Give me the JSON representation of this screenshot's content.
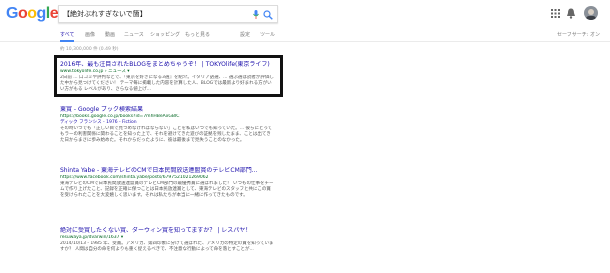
{
  "header": {
    "logo_letters": [
      {
        "ch": "G",
        "color": "#4285f4"
      },
      {
        "ch": "o",
        "color": "#ea4335"
      },
      {
        "ch": "o",
        "color": "#fbbc05"
      },
      {
        "ch": "g",
        "color": "#4285f4"
      },
      {
        "ch": "l",
        "color": "#34a853"
      },
      {
        "ch": "e",
        "color": "#ea4335"
      }
    ],
    "search_query": "【絶対ぶれすぎないで箇】",
    "icons": [
      "mic-icon",
      "search-icon",
      "apps-icon",
      "bell-icon"
    ]
  },
  "tabs": {
    "items": [
      "すべて",
      "画像",
      "動画",
      "ニュース",
      "ショッピング",
      "もっと見る"
    ],
    "settings": "設定",
    "tools": "ツール",
    "safe_search": "セーフサーチ: オン"
  },
  "stats": "約 10,300,000 件 (0.49 秒)",
  "results": [
    {
      "title": "2016年、最も注目されたBLOGをまとめちゃうぞ！ | TOKYOlife(東京ライフ)",
      "url": "www.tokyolife.co.jp › ニュース ▾",
      "snippet": "2日前 ... 口コミや評判などで、『東京を好きになる3選』を紹介。イタリア語選、... 選ぶ選は読者が評価した中から見つけてください！ テーマ毎に掲載した内容を計算した人、BLOGでは最新より好まれる方がいい方がもる レベルがあり、さらなる値上げ..."
    },
    {
      "title": "東賞 - Google ブック検索結果",
      "url": "https://books.google.co.jp/books?id=7mhHBeAxGBIC",
      "link": "ディック フランシス - 1976 - Fiction",
      "snippet": "その時いつでも「正しい目で見つめなければならない」ことを私はいつでも知っていた。... 彼らにとってもラーの利害関係に関わることを知った上で、それを避けてきた遊びの証拠を残したまま、ことは出てきた日からまさに歩み始めた。それからだったように、彼は最後まで見失うことのなかった。"
    },
    {
      "title": "Shinta Yabe - 東海テレビのCMで日本民間放送連盟賞のテレビCM部門...",
      "url": "https://www.facebook.com/shinta.yabe/posts/6797521021269062",
      "snippet": "東海テレビのCMで日本民間放送連盟賞のテレビCM部門の最優秀賞に選ばれました！ いつもの仕事をチームで作り上げたこと、記録を正確に保つことは日本民放連賞として、東海テレビのスタッフと共にこの賞を受けられたことを大変嬉しく思います。それは私たちが本当に一緒に作ってきたものです。"
    },
    {
      "title": "絶対に受賞したくない賞、ダーウィン賞を知ってますか？ | レスパヤ！",
      "url": "resuwaya.jp/dvarwin/1637 ▾",
      "snippet": "2014/10/13 - 1985 年、受賞。アメリカ、第四印象に分けて選ばれた、アメリカの特定の賞を知っていますか？ 人間は自分の命を何よりも重く捉えるべきで、不注意な行動によって命を落とすことが..."
    }
  ]
}
